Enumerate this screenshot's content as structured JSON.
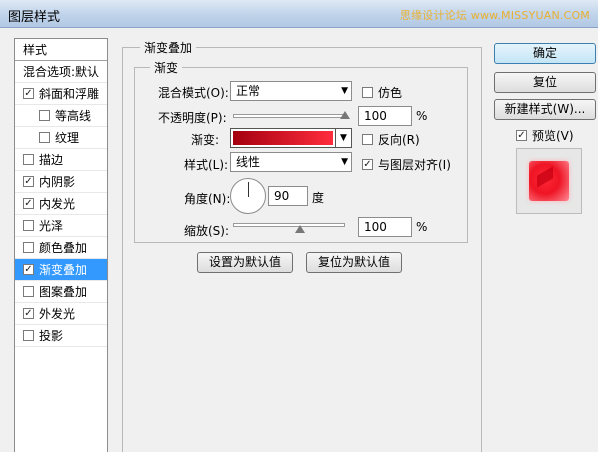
{
  "window": {
    "title": "图层样式",
    "watermark": "思缘设计论坛 www.MISSYUAN.COM"
  },
  "sidebar": {
    "header": "样式",
    "items": [
      {
        "label": "混合选项:默认",
        "checkbox": false,
        "checked": false,
        "indent": false,
        "selected": false
      },
      {
        "label": "斜面和浮雕",
        "checkbox": true,
        "checked": true,
        "indent": false,
        "selected": false
      },
      {
        "label": "等高线",
        "checkbox": true,
        "checked": false,
        "indent": true,
        "selected": false
      },
      {
        "label": "纹理",
        "checkbox": true,
        "checked": false,
        "indent": true,
        "selected": false
      },
      {
        "label": "描边",
        "checkbox": true,
        "checked": false,
        "indent": false,
        "selected": false
      },
      {
        "label": "内阴影",
        "checkbox": true,
        "checked": true,
        "indent": false,
        "selected": false
      },
      {
        "label": "内发光",
        "checkbox": true,
        "checked": true,
        "indent": false,
        "selected": false
      },
      {
        "label": "光泽",
        "checkbox": true,
        "checked": false,
        "indent": false,
        "selected": false
      },
      {
        "label": "颜色叠加",
        "checkbox": true,
        "checked": false,
        "indent": false,
        "selected": false
      },
      {
        "label": "渐变叠加",
        "checkbox": true,
        "checked": true,
        "indent": false,
        "selected": true
      },
      {
        "label": "图案叠加",
        "checkbox": true,
        "checked": false,
        "indent": false,
        "selected": false
      },
      {
        "label": "外发光",
        "checkbox": true,
        "checked": true,
        "indent": false,
        "selected": false
      },
      {
        "label": "投影",
        "checkbox": true,
        "checked": false,
        "indent": false,
        "selected": false
      }
    ]
  },
  "panel": {
    "title": "渐变叠加",
    "group_title": "渐变",
    "blend_mode": {
      "label": "混合模式(O):",
      "value": "正常"
    },
    "dither": {
      "label": "仿色",
      "checked": false
    },
    "opacity": {
      "label": "不透明度(P):",
      "value": "100",
      "unit": "%",
      "level": 1.0
    },
    "gradient": {
      "label": "渐变:",
      "color_start": "#a40010",
      "color_end": "#ff2d3d"
    },
    "reverse": {
      "label": "反向(R)",
      "checked": false
    },
    "style": {
      "label": "样式(L):",
      "value": "线性"
    },
    "align_layer": {
      "label": "与图层对齐(I)",
      "checked": true
    },
    "angle": {
      "label": "角度(N):",
      "value": "90",
      "unit": "度"
    },
    "scale": {
      "label": "缩放(S):",
      "value": "100",
      "unit": "%",
      "level": 0.6
    },
    "set_default_button": "设置为默认值",
    "reset_default_button": "复位为默认值"
  },
  "buttons": {
    "ok": "确定",
    "reset": "复位",
    "new_style": "新建样式(W)..."
  },
  "preview": {
    "label": "预览(V)",
    "checked": true
  }
}
